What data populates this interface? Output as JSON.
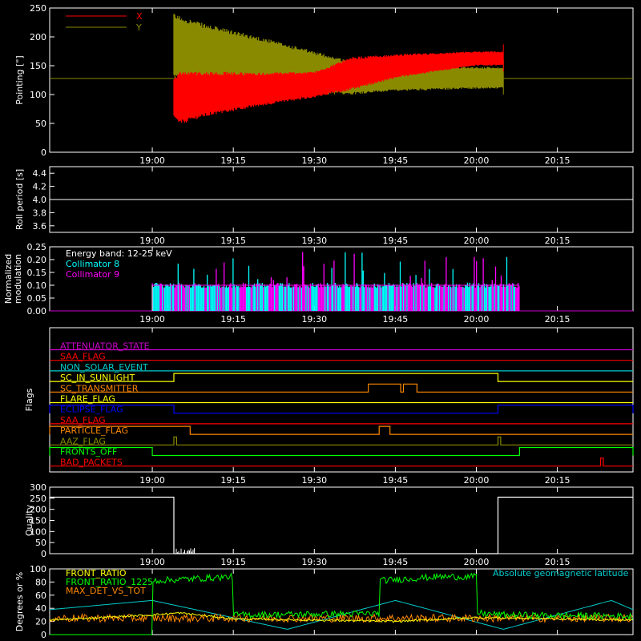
{
  "time_ticks": [
    "19:00",
    "19:15",
    "19:30",
    "19:45",
    "20:00",
    "20:15"
  ],
  "chart_data": [
    {
      "id": "pointing",
      "type": "line",
      "ylabel": "Pointing [\"]",
      "ylim": [
        0,
        250
      ],
      "yticks": [
        "0",
        "50",
        "100",
        "150",
        "200",
        "250"
      ],
      "legend": [
        {
          "name": "X",
          "color": "#ff0000"
        },
        {
          "name": "Y",
          "color": "#8a8a00"
        }
      ],
      "baseline": 128,
      "series_envelopes": [
        {
          "name": "Y",
          "color": "#8a8a00",
          "time": [
            "19:04",
            "19:10",
            "19:20",
            "19:30",
            "19:37",
            "19:45",
            "20:00",
            "20:05"
          ],
          "upper": [
            240,
            222,
            200,
            175,
            158,
            150,
            148,
            148
          ],
          "lower": [
            128,
            118,
            108,
            100,
            100,
            106,
            110,
            110
          ]
        },
        {
          "name": "X",
          "color": "#ff0000",
          "time": [
            "19:04",
            "19:05",
            "19:10",
            "19:20",
            "19:30",
            "19:37",
            "19:45",
            "20:00",
            "20:05"
          ],
          "upper": [
            128,
            140,
            140,
            138,
            140,
            165,
            170,
            175,
            175
          ],
          "lower": [
            60,
            48,
            62,
            80,
            95,
            108,
            128,
            150,
            150
          ]
        }
      ]
    },
    {
      "id": "roll",
      "type": "line",
      "ylabel": "Roll period [s]",
      "ylim": [
        3.5,
        4.5
      ],
      "yticks": [
        "3.6",
        "3.8",
        "4.0",
        "4.2",
        "4.4"
      ],
      "series": [
        {
          "name": "Roll period",
          "value": 4.0
        }
      ]
    },
    {
      "id": "modulation",
      "type": "bar",
      "ylabel": [
        "Normalized",
        "modulation"
      ],
      "ylim": [
        0,
        0.25
      ],
      "yticks": [
        "0.00",
        "0.05",
        "0.10",
        "0.15",
        "0.20",
        "0.25"
      ],
      "annotation": "Energy band: 12-25 keV",
      "legend": [
        {
          "name": "Collimator 8",
          "color": "#00ffff"
        },
        {
          "name": "Collimator 9",
          "color": "#ff00ff"
        }
      ],
      "active_range": [
        "19:00",
        "20:08"
      ],
      "typical_level": 0.1
    },
    {
      "id": "flags",
      "type": "line",
      "ylabel": "Flags",
      "flags": [
        {
          "name": "ATTENUATOR_STATE",
          "color": "#cc00cc",
          "on": []
        },
        {
          "name": "SAA_FLAG",
          "color": "#ff0000",
          "on": []
        },
        {
          "name": "NON_SOLAR_EVENT",
          "color": "#00cccc",
          "on": []
        },
        {
          "name": "SC_IN_SUNLIGHT",
          "color": "#ffff00",
          "on": [
            [
              "19:04",
              "20:04"
            ]
          ]
        },
        {
          "name": "SC_TRANSMITTER",
          "color": "#ff8800",
          "on": [
            [
              "19:40",
              "19:46"
            ],
            [
              "19:46.5",
              "19:49"
            ]
          ]
        },
        {
          "name": "FLARE_FLAG",
          "color": "#ffff00",
          "on": []
        },
        {
          "name": "ECLIPSE_FLAG",
          "color": "#0000ff",
          "on": [
            [
              "-",
              "19:04"
            ],
            [
              "20:04",
              "+"
            ]
          ]
        },
        {
          "name": "SAA_FLAG",
          "color": "#ff0000",
          "on": []
        },
        {
          "name": "PARTICLE_FLAG",
          "color": "#ff8800",
          "on": [
            [
              "-",
              "19:07"
            ],
            [
              "19:42",
              "19:44"
            ]
          ]
        },
        {
          "name": "AAZ_FLAG",
          "color": "#8a8a00",
          "on": [
            [
              "19:04",
              "19:04.5"
            ],
            [
              "20:04",
              "20:04.5"
            ]
          ]
        },
        {
          "name": "FRONTS_OFF",
          "color": "#00ff00",
          "on": [
            [
              "-",
              "19:00"
            ],
            [
              "20:08",
              "+"
            ]
          ]
        },
        {
          "name": "BAD_PACKETS",
          "color": "#ff0000",
          "on": [
            [
              "20:23",
              "20:23.5"
            ]
          ]
        }
      ]
    },
    {
      "id": "quality",
      "type": "line",
      "ylabel": "Quality",
      "ylim": [
        0,
        300
      ],
      "yticks": [
        "0",
        "50",
        "100",
        "150",
        "200",
        "250",
        "300"
      ],
      "series": [
        {
          "name": "Quality",
          "time": [
            "-",
            "19:04",
            "19:04",
            "20:04",
            "20:04",
            "+"
          ],
          "values": [
            255,
            255,
            0,
            0,
            255,
            255
          ]
        }
      ]
    },
    {
      "id": "ratios",
      "type": "line",
      "ylabel": "Degrees or %",
      "ylim": [
        0,
        100
      ],
      "yticks": [
        "0",
        "20",
        "40",
        "60",
        "80",
        "100"
      ],
      "legend": [
        {
          "name": "FRONT_RATIO",
          "color": "#ffff00"
        },
        {
          "name": "FRONT_RATIO_1225",
          "color": "#00ff00"
        },
        {
          "name": "MAX_DET_VS_TOT",
          "color": "#ff8800"
        }
      ],
      "latitude_label": "Absolute geomagnetic latitude",
      "latitude_color": "#00cccc",
      "series": [
        {
          "name": "FRONT_RATIO_1225",
          "time": [
            "-",
            "19:00",
            "19:00",
            "19:15",
            "19:15",
            "19:42",
            "19:42",
            "19:53",
            "20:00",
            "20:00",
            "20:05",
            "+"
          ],
          "values": [
            0,
            0,
            82,
            88,
            30,
            32,
            82,
            88,
            88,
            33,
            30,
            28
          ]
        },
        {
          "name": "FRONT_RATIO",
          "time": [
            "-",
            "19:00",
            "19:05",
            "19:15",
            "19:45",
            "20:00",
            "+"
          ],
          "values": [
            22,
            30,
            33,
            24,
            20,
            26,
            22
          ]
        },
        {
          "name": "MAX_DET_VS_TOT",
          "time": [
            "-",
            "+"
          ],
          "values": [
            25,
            25
          ]
        }
      ],
      "latitude": {
        "time": [
          "-",
          "19:00",
          "19:25",
          "19:45",
          "20:05",
          "20:25",
          "+"
        ],
        "values": [
          38,
          52,
          8,
          52,
          8,
          52,
          38
        ]
      }
    }
  ]
}
